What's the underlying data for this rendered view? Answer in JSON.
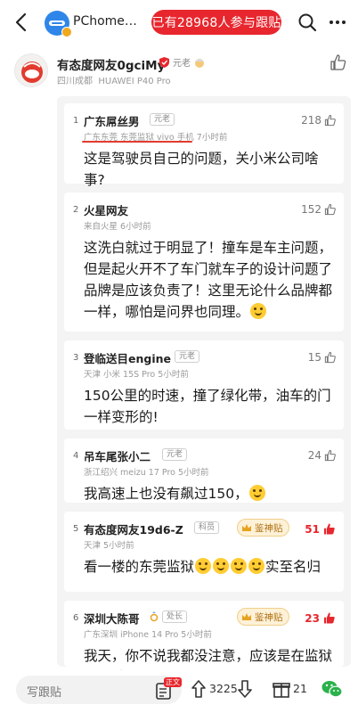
{
  "header": {
    "site_name": "PChome…",
    "follow_text": "已有28968人参与跟贴"
  },
  "post": {
    "author": "有态度网友0gciMy",
    "tag": "元老",
    "location": "四川成都",
    "device": "HUAWEI P40 Pro"
  },
  "comments": [
    {
      "index": "1",
      "name": "广东屌丝男",
      "tag": "元老",
      "meta": "广东东莞  东莞监狱  vivo 手机  7小时前",
      "likes": "218",
      "text": "这是驾驶员自己的问题，关小米公司啥事?"
    },
    {
      "index": "2",
      "name": "火星网友",
      "tag": "",
      "meta": "来自火星  6小时前",
      "likes": "152",
      "text": "这洗白就过于明显了！撞车是车主问题，但是起火开不了车门就车子的设计问题了品牌是应该负责了！这里无论什么品牌都一样，哪怕是问界也同理。"
    },
    {
      "index": "3",
      "name": "登临送目engine",
      "tag": "元老",
      "meta": "天津  小米 15S Pro  5小时前",
      "likes": "15",
      "text": "150公里的时速，撞了绿化带，油车的门一样变形的!"
    },
    {
      "index": "4",
      "name": "吊车尾张小二",
      "tag": "元老",
      "meta": "浙江绍兴  meizu 17 Pro  5小时前",
      "likes": "24",
      "text": "我高速上也没有飙过150，"
    },
    {
      "index": "5",
      "name": "有态度网友19d6-Z",
      "tag": "科员",
      "meta": "天津  5小时前",
      "likes": "51",
      "badge": "鉴神贴",
      "text_a": "看一楼的东莞监狱",
      "text_b": "实至名归"
    },
    {
      "index": "6",
      "name": "深圳大陈哥",
      "tag": "处长",
      "meta": "广东深圳  iPhone 14 Pro  5小时前",
      "likes": "23",
      "badge": "鉴神贴",
      "text": "我天，你不说我都没注意，应该是在监狱里做辅警的或保安"
    }
  ],
  "bottom": {
    "placeholder": "写跟贴",
    "zheng_badge": "正文",
    "votes": "3225",
    "gifts": "21"
  },
  "colors": {
    "accent_red": "#e8262d",
    "panel_gray": "#f4f4f4",
    "gold": "#b07214"
  }
}
